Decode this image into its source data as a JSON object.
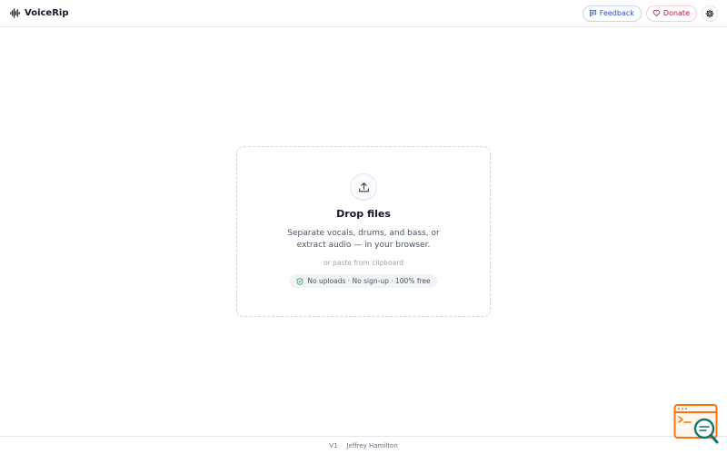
{
  "header": {
    "app_name": "VoiceRip",
    "logo_icon": "audio-wave-icon",
    "feedback_label": "Feedback",
    "donate_label": "Donate",
    "settings_icon": "gear-icon"
  },
  "dropzone": {
    "icon": "upload-icon",
    "title": "Drop files",
    "description": "Separate vocals, drums, and bass, or extract audio — in your browser.",
    "paste_hint": "or paste from clipboard",
    "badge_text": "No uploads · No sign-up · 100% free",
    "badge_icon": "shield-check-icon"
  },
  "footer": {
    "version": "V1",
    "author": "Jeffrey Hamilton"
  },
  "colors": {
    "feedback": "#1d4ed8",
    "donate": "#be123c",
    "badge_check": "#16a34a",
    "widget_orange": "#f97316",
    "widget_teal": "#0f766e"
  }
}
